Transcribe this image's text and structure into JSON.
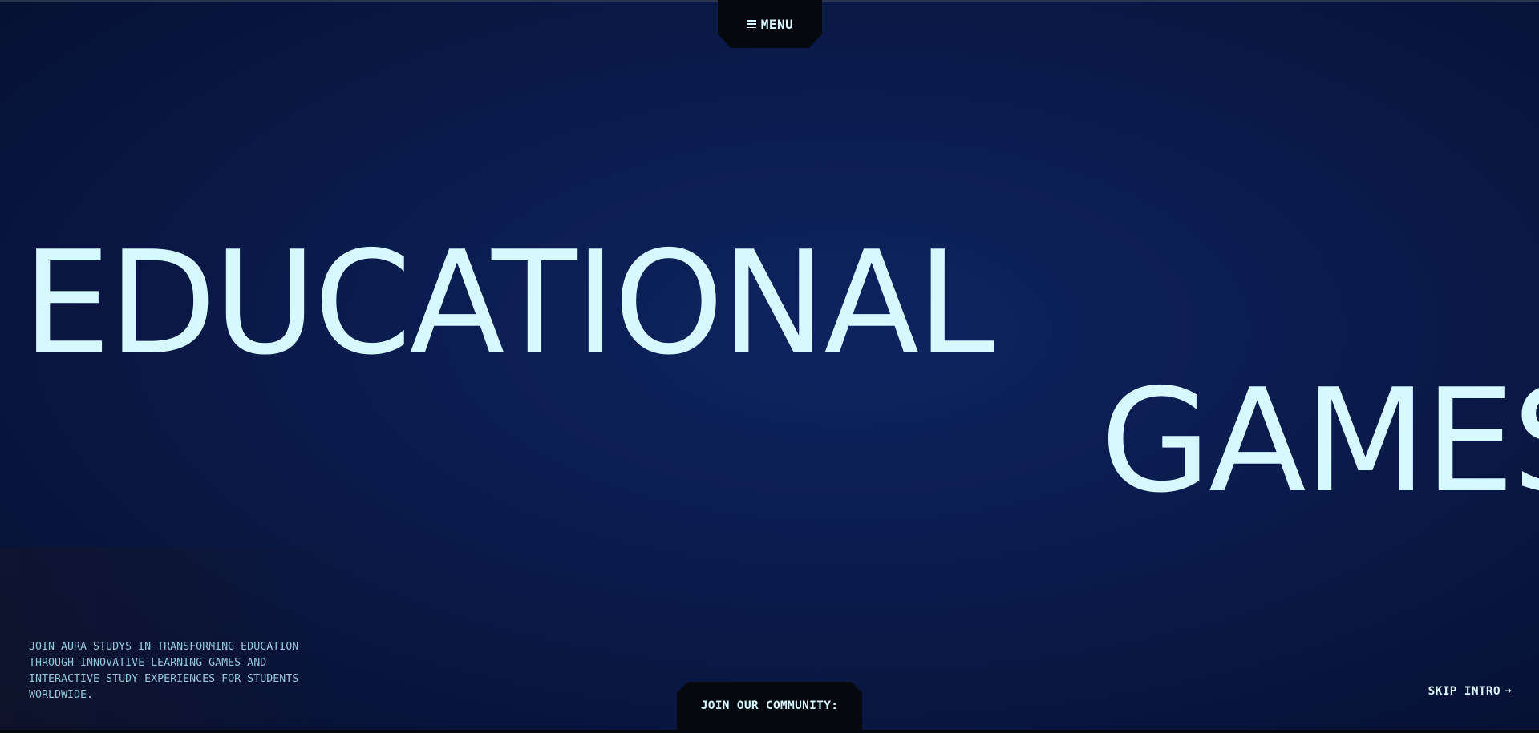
{
  "nav": {
    "menu_label": "MENU",
    "menu_icon": "hamburger-icon"
  },
  "hero": {
    "title_line1": "EDUCATIONAL",
    "title_line2": "GAMES",
    "description": "JOIN AURA STUDYS IN TRANSFORMING EDUCATION THROUGH INNOVATIVE LEARNING GAMES AND INTERACTIVE STUDY EXPERIENCES FOR STUDENTS WORLDWIDE."
  },
  "footer": {
    "community_label": "JOIN OUR COMMUNITY:",
    "skip_label": "SKIP INTRO",
    "skip_arrow": "➜"
  },
  "colors": {
    "background": "#0b1a45",
    "headline": "#d6f8ff",
    "body_text": "#8fc6d8",
    "tab_background": "#05080f"
  }
}
